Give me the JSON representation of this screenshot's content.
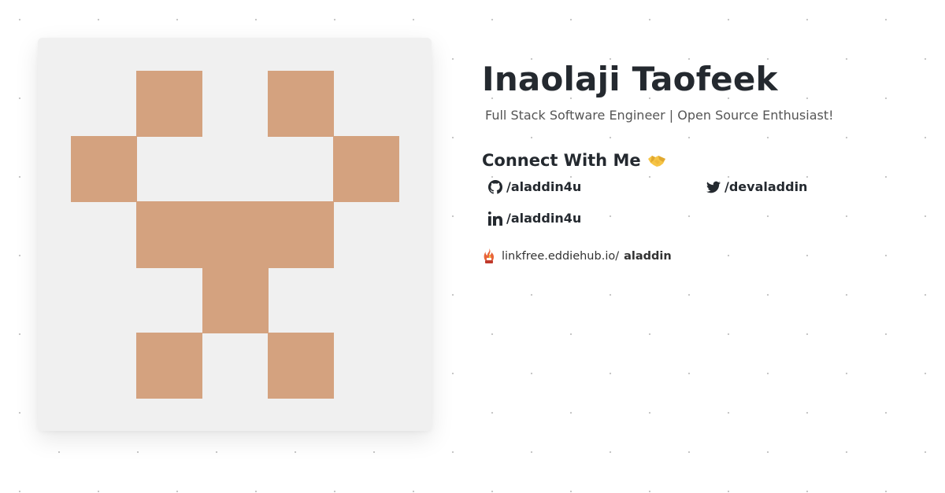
{
  "profile": {
    "name": "Inaolaji Taofeek",
    "tagline": "Full Stack Software Engineer | Open Source Enthusiast!"
  },
  "avatar": {
    "description_icon": "identicon-avatar",
    "background_color": "#f0f0f0",
    "fill_color": "#d4a27f"
  },
  "connect": {
    "heading": "Connect With Me",
    "heading_icon": "handshake-icon"
  },
  "links": {
    "github": {
      "icon": "github-icon",
      "label": "/aladdin4u"
    },
    "twitter": {
      "icon": "twitter-icon",
      "label": "/devaladdin"
    },
    "linkedin": {
      "icon": "linkedin-icon",
      "label": "/aladdin4u"
    }
  },
  "linkfree": {
    "icon": "linkfree-flame-icon",
    "prefix": "linkfree.eddiehub.io/",
    "username": "aladdin"
  }
}
